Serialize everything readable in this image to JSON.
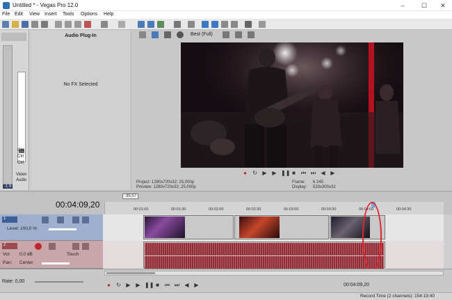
{
  "window": {
    "title": "Untitled * - Vegas Pro 12.0",
    "controls": [
      "–",
      "☐",
      "✕"
    ]
  },
  "menu": [
    "File",
    "Edit",
    "View",
    "Insert",
    "Tools",
    "Options",
    "Help"
  ],
  "mixer": {
    "label_video": "Video",
    "label_audio": "Audio",
    "ctrl_labels": [
      "Ctrl",
      "Ctrl",
      "Ctrl"
    ],
    "level": "-1.9"
  },
  "fx_panel": {
    "title": "Audio Plug-In",
    "status": "No FX Selected"
  },
  "preview": {
    "quality": "Best (Full)",
    "project": "Project:  1280x720x32; 25,000p",
    "preview_line": "Preview:  1280x720x32; 25,000p",
    "frame_label": "Frame:",
    "frame_value": "6 245",
    "display_label": "Display:",
    "display_value": "533x300x32"
  },
  "timeline": {
    "timecode": "00:04:09,20",
    "cursor_marker": "-35,57",
    "ticks": [
      "00:01:00",
      "00:01:30",
      "00:02:00",
      "00:02:30",
      "00:03:00",
      "00:03:30",
      "00:04:00",
      "00:04:30"
    ]
  },
  "video_track": {
    "number": "1",
    "level_label": "Level: 100,0 %"
  },
  "audio_track": {
    "number": "2",
    "vol_label": "Vol:",
    "vol_value": "0,0 dB",
    "pan_label": "Pan:",
    "pan_value": "Center",
    "automation": "Touch"
  },
  "bottom": {
    "rate": "Rate: 0,00",
    "end_timecode": "00:04:09,20",
    "status": "Record Time (2 channels): 154:19:40"
  },
  "colors": {
    "video_header": "#9fb0cf",
    "audio_header": "#c9a6a9",
    "highlight": "#e0242e"
  }
}
